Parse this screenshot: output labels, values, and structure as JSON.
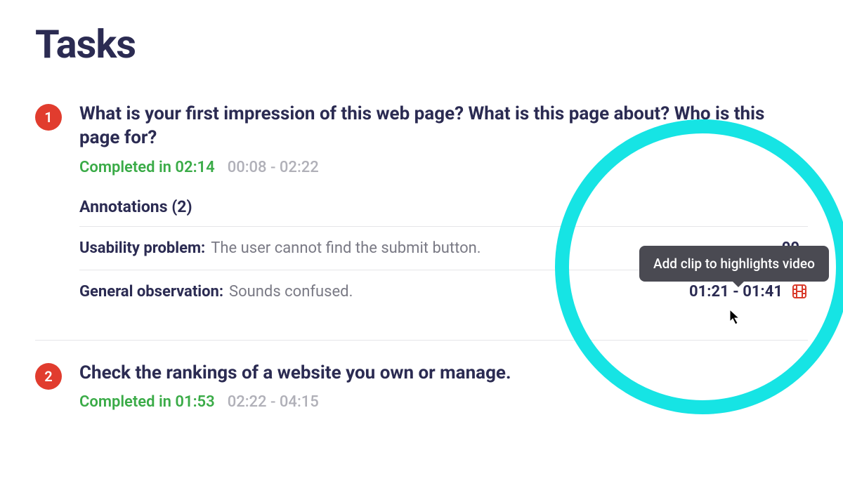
{
  "page_title": "Tasks",
  "tooltip_text": "Add clip to highlights video",
  "tasks": [
    {
      "number": "1",
      "question": "What is your first impression of this web page? What is this page about? Who is this page for?",
      "completed_label": "Completed in 02:14",
      "time_range": "00:08 - 02:22",
      "annotations_header": "Annotations (2)",
      "annotations": [
        {
          "label": "Usability problem:",
          "text": "The user cannot find the submit button.",
          "time": "00"
        },
        {
          "label": "General observation:",
          "text": "Sounds confused.",
          "time": "01:21 - 01:41"
        }
      ]
    },
    {
      "number": "2",
      "question": "Check the rankings of a website you own or manage.",
      "completed_label": "Completed in 01:53",
      "time_range": "02:22 - 04:15"
    }
  ]
}
